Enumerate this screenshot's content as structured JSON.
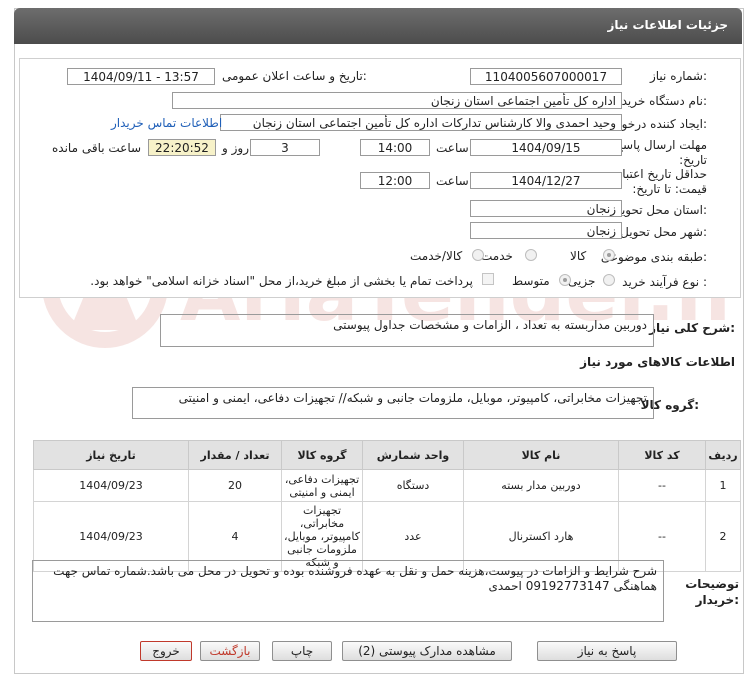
{
  "header": {
    "title": "جزئیات اطلاعات نیاز"
  },
  "fields": {
    "need_number_label": "شماره نیاز:",
    "need_number": "1104005607000017",
    "announce_label": "تاریخ و ساعت اعلان عمومی:",
    "announce_value": "1404/09/11 - 13:57",
    "buyer_org_label": "نام دستگاه خریدار:",
    "buyer_org": "اداره کل تأمین اجتماعی استان زنجان",
    "requester_label": "ایجاد کننده درخواست:",
    "requester": "وحید احمدی والا کارشناس تدارکات اداره کل تأمین اجتماعی استان زنجان",
    "contact_link": "اطلاعات تماس خریدار",
    "deadline_label": "مهلت ارسال پاسخ: تا تاریخ:",
    "deadline_date": "1404/09/15",
    "time_label": "ساعت",
    "deadline_time": "14:00",
    "days_count": "3",
    "days_and_label": "روز و",
    "remaining_time": "22:20:52",
    "remaining_label": "ساعت باقی مانده",
    "validity_label": "حداقل تاریخ اعتبار قیمت: تا تاریخ:",
    "validity_date": "1404/12/27",
    "validity_time": "12:00",
    "province_label": "استان محل تحویل:",
    "province": "زنجان",
    "city_label": "شهر محل تحویل:",
    "city": "زنجان",
    "category_label": "طبقه بندی موضوعی:",
    "category_options": [
      "کالا",
      "خدمت",
      "کالا/خدمت"
    ],
    "purchase_type_label": "نوع فرآیند خرید :",
    "purchase_options": [
      "جزیی",
      "متوسط"
    ],
    "payment_note": "پرداخت تمام یا بخشی از مبلغ خرید،از محل \"اسناد خزانه اسلامی\" خواهد بود."
  },
  "need_summary": {
    "label": "شرح کلی نیاز:",
    "value": "دوربین مداربسته به تعداد ، الزامات و مشخصات جداول پیوستی"
  },
  "goods_section_title": "اطلاعات کالاهای مورد نیاز",
  "goods_group": {
    "label": "گروه کالا:",
    "value": "تجهیزات مخابراتی، کامپیوتر، موبایل، ملزومات جانبی و شبکه// تجهیزات دفاعی، ایمنی و امنیتی"
  },
  "table": {
    "headers": [
      "ردیف",
      "کد کالا",
      "نام کالا",
      "واحد شمارش",
      "گروه کالا",
      "تعداد / مقدار",
      "تاریخ نیاز"
    ],
    "rows": [
      [
        "1",
        "--",
        "دوربین مدار بسته",
        "دستگاه",
        "تجهیزات دفاعی، ایمنی و امنیتی",
        "20",
        "1404/09/23"
      ],
      [
        "2",
        "--",
        "هارد اکسترنال",
        "عدد",
        "تجهیزات مخابراتی، کامپیوتر، موبایل، ملزومات جانبی و شبکه",
        "4",
        "1404/09/23"
      ]
    ]
  },
  "buyer_notes": {
    "label": "توضیحات خریدار:",
    "value": "شرح شرایط و الزامات در پیوست،هزینه حمل و نقل به عهده فروشنده بوده و تحویل در محل می باشد.شماره تماس جهت هماهنگی 09192773147 احمدی"
  },
  "buttons": {
    "reply": "پاسخ به نیاز",
    "attachments": "مشاهده مدارک پیوستی (2)",
    "print": "چاپ",
    "back": "بازگشت",
    "exit": "خروج"
  },
  "watermark": "AriaTender.neT",
  "colors": {
    "link": "#1f5fb8",
    "highlight": "#f7f2c9",
    "exit_border": "#c0392b"
  }
}
